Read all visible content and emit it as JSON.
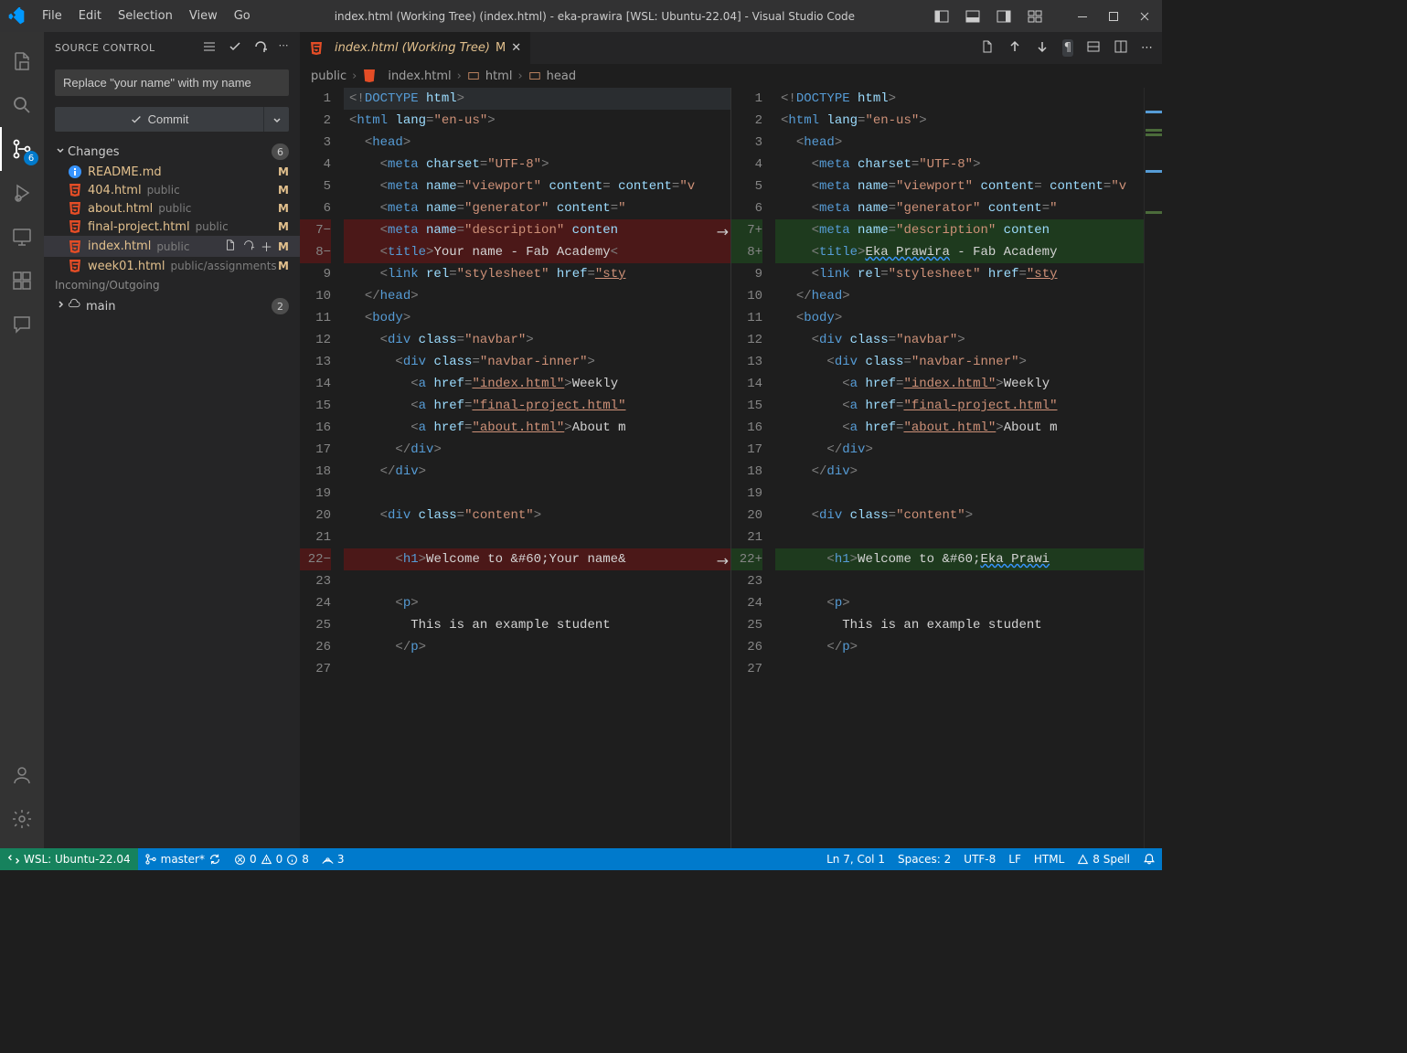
{
  "window": {
    "title": "index.html (Working Tree) (index.html) - eka-prawira [WSL: Ubuntu-22.04] - Visual Studio Code"
  },
  "menu": [
    "File",
    "Edit",
    "Selection",
    "View",
    "Go"
  ],
  "sidebar": {
    "title": "SOURCE CONTROL",
    "commit_placeholder": "Replace \"your name\" with my name",
    "commit_btn": "Commit",
    "changes_label": "Changes",
    "changes_count": "6",
    "files": [
      {
        "name": "README.md",
        "path": "",
        "status": "M",
        "icon": "info"
      },
      {
        "name": "404.html",
        "path": "public",
        "status": "M",
        "icon": "html"
      },
      {
        "name": "about.html",
        "path": "public",
        "status": "M",
        "icon": "html"
      },
      {
        "name": "final-project.html",
        "path": "public",
        "status": "M",
        "icon": "html"
      },
      {
        "name": "index.html",
        "path": "public",
        "status": "M",
        "icon": "html",
        "selected": true
      },
      {
        "name": "week01.html",
        "path": "public/assignments",
        "status": "M",
        "icon": "html"
      }
    ],
    "incoming_label": "Incoming/Outgoing",
    "main_label": "main",
    "main_count": "2"
  },
  "scm_badge": "6",
  "tab": {
    "label": "index.html (Working Tree)",
    "dirty_mark": "M"
  },
  "breadcrumb": [
    "public",
    "index.html",
    "html",
    "head"
  ],
  "left_lines": [
    "1",
    "2",
    "3",
    "4",
    "5",
    "6",
    "7",
    "8",
    "9",
    "10",
    "11",
    "12",
    "13",
    "14",
    "15",
    "16",
    "17",
    "18",
    "19",
    "20",
    "21",
    "22",
    "23",
    "24",
    "25",
    "26",
    "27",
    ""
  ],
  "right_lines": [
    "1",
    "2",
    "3",
    "4",
    "5",
    "6",
    "7",
    "8",
    "9",
    "10",
    "11",
    "12",
    "13",
    "14",
    "15",
    "16",
    "17",
    "18",
    "19",
    "20",
    "21",
    "22",
    "23",
    "24",
    "25",
    "26",
    "27",
    ""
  ],
  "code_left": {
    "l1": "<!DOCTYPE html>",
    "l8_title": "Your name - Fab Academy",
    "l22_h1": "Welcome to &#60;Your name&"
  },
  "code_right": {
    "l8_title": "Eka Prawira - Fab Academy",
    "l22_h1": "Welcome to &#60;Eka Prawi"
  },
  "shared": {
    "lang": "en-us",
    "charset": "UTF-8",
    "viewport_name": "viewport",
    "generator_name": "generator",
    "description_name": "description",
    "rel": "stylesheet",
    "navbar": "navbar",
    "navbar_inner": "navbar-inner",
    "content_cls": "content",
    "link_index": "index.html",
    "link_final": "final-project.html",
    "link_about": "about.html",
    "weekly": "Weekly",
    "about_txt": "About m",
    "para": "This is an example student "
  },
  "status": {
    "remote": "WSL: Ubuntu-22.04",
    "branch": "master*",
    "errors": "0",
    "warnings": "0",
    "infos": "8",
    "ports": "3",
    "ln_col": "Ln 7, Col 1",
    "spaces": "Spaces: 2",
    "encoding": "UTF-8",
    "eol": "LF",
    "lang": "HTML",
    "spell": "8 Spell"
  }
}
